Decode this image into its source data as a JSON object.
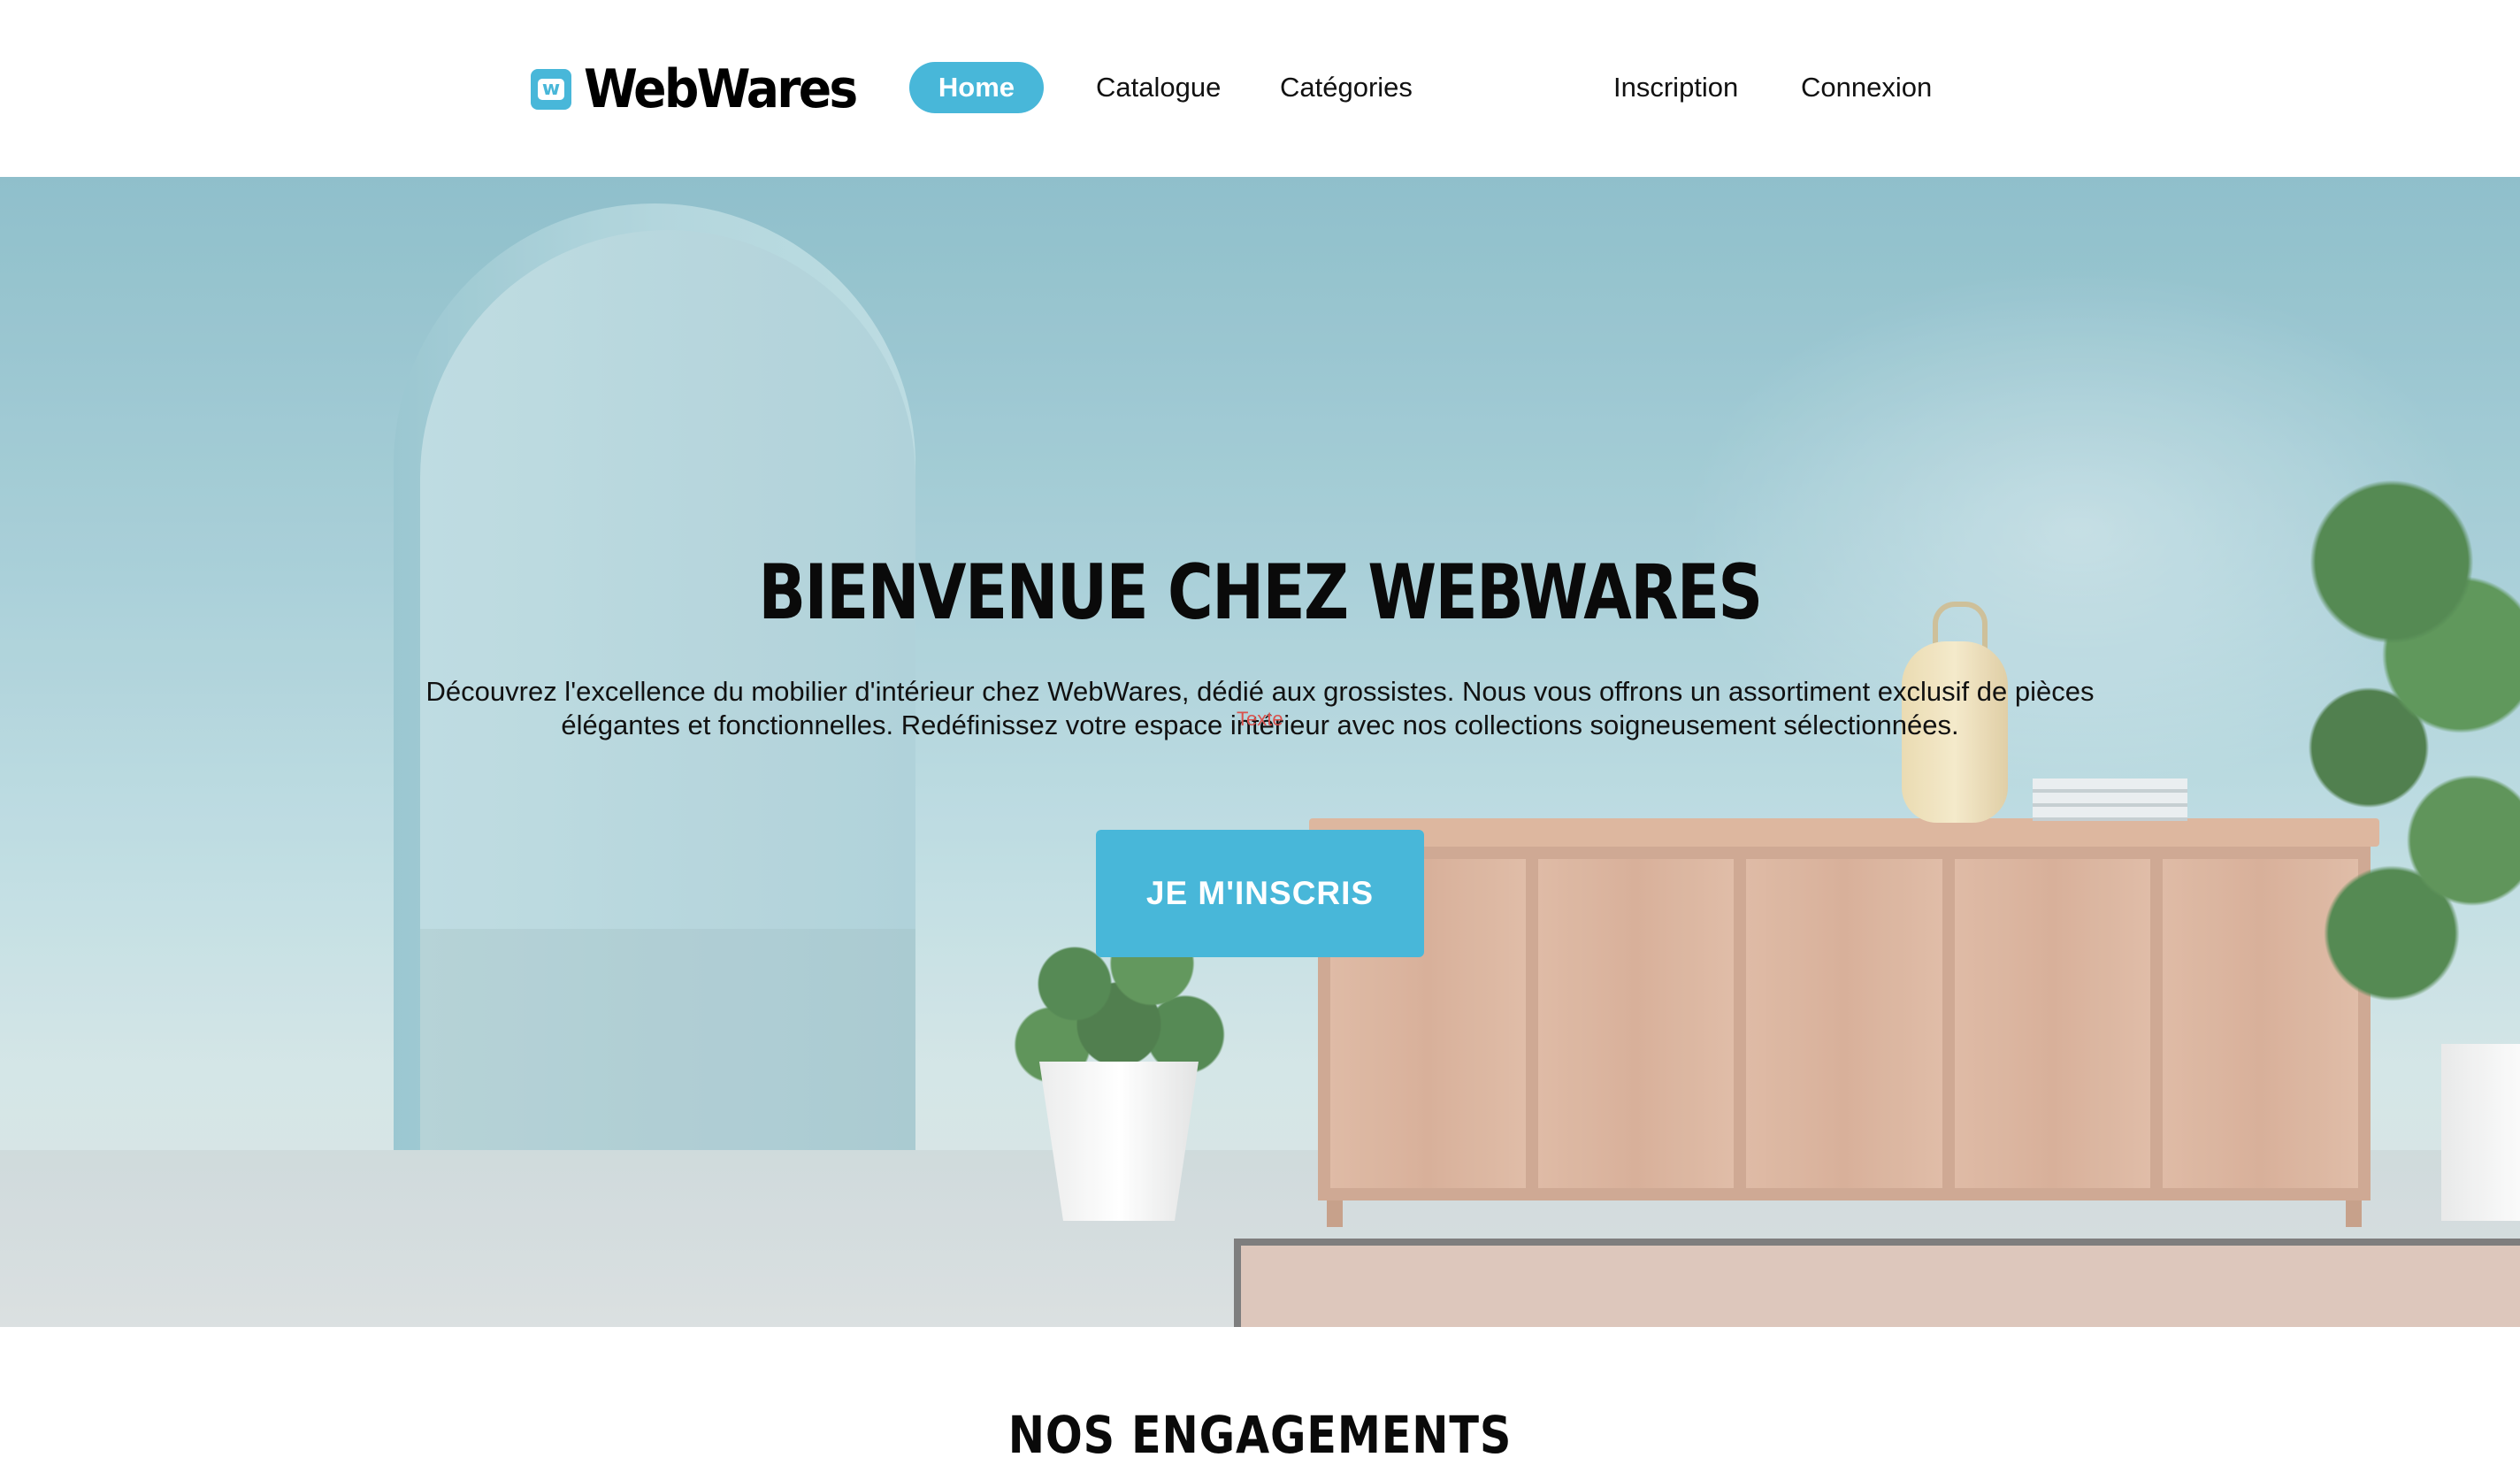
{
  "header": {
    "logo_text": "WebWares",
    "logo_icon": "w-square-icon",
    "nav": {
      "home": "Home",
      "catalogue": "Catalogue",
      "categories": "Catégories",
      "inscription": "Inscription",
      "connexion": "Connexion"
    }
  },
  "hero": {
    "title": "BIENVENUE CHEZ WEBWARES",
    "description_line1": "Découvrez l'excellence du mobilier d'intérieur chez WebWares, dédié aux grossistes. Nous vous offrons un assortiment exclusif de pièces",
    "description_line2": "élégantes et fonctionnelles. Redéfinissez votre espace intérieur avec nos collections soigneusement sélectionnées.",
    "tag": "Texte",
    "cta_label": "JE M'INSCRIS"
  },
  "section": {
    "title": "NOS ENGAGEMENTS"
  },
  "colors": {
    "accent": "#48b7d9",
    "text": "#111111",
    "background": "#ffffff"
  }
}
